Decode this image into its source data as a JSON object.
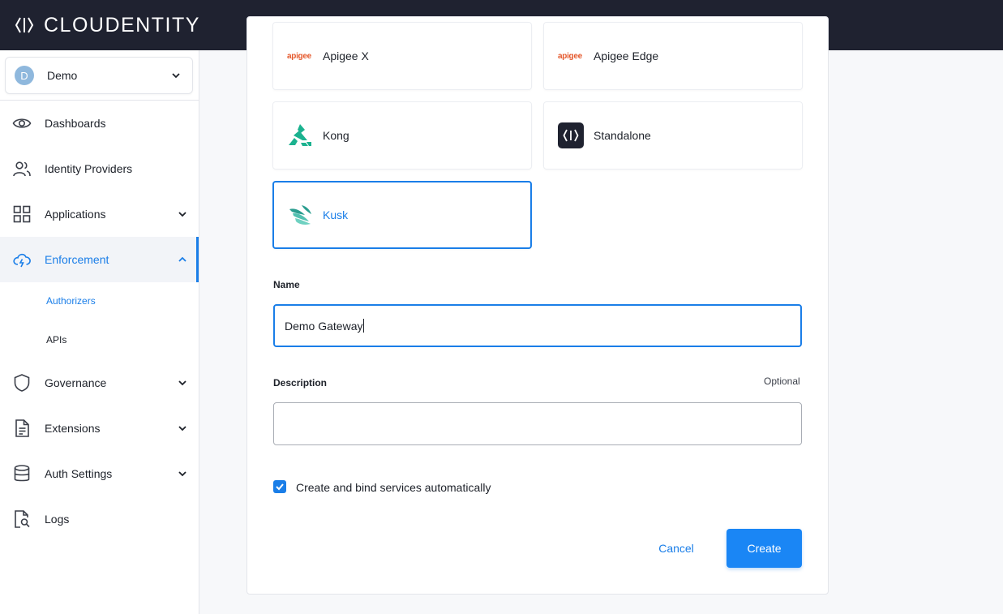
{
  "app": {
    "name": "CLOUDENTITY"
  },
  "tenant": {
    "avatar_letter": "D",
    "name": "Demo"
  },
  "sidebar": {
    "items": [
      {
        "label": "Dashboards",
        "icon": "eye-icon"
      },
      {
        "label": "Identity Providers",
        "icon": "users-icon"
      },
      {
        "label": "Applications",
        "icon": "grid-icon"
      },
      {
        "label": "Enforcement",
        "icon": "cloud-bolt-icon"
      },
      {
        "label": "Governance",
        "icon": "shield-icon"
      },
      {
        "label": "Extensions",
        "icon": "document-icon"
      },
      {
        "label": "Auth Settings",
        "icon": "database-icon"
      },
      {
        "label": "Logs",
        "icon": "file-search-icon"
      }
    ],
    "sub_items": [
      {
        "label": "Authorizers"
      },
      {
        "label": "APIs"
      }
    ]
  },
  "gateways": [
    {
      "label": "Apigee X",
      "logo_text": "apigee"
    },
    {
      "label": "Apigee Edge",
      "logo_text": "apigee"
    },
    {
      "label": "Kong"
    },
    {
      "label": "Standalone"
    },
    {
      "label": "Kusk"
    }
  ],
  "form": {
    "name_label": "Name",
    "name_value": "Demo Gateway",
    "description_label": "Description",
    "optional_label": "Optional",
    "description_value": "",
    "checkbox_label": "Create and bind services automatically",
    "checkbox_checked": true,
    "cancel_label": "Cancel",
    "create_label": "Create"
  },
  "colors": {
    "accent": "#1a7ee8",
    "topbar": "#1f2230",
    "apigee": "#e5592d",
    "kong": "#1bb28f"
  }
}
